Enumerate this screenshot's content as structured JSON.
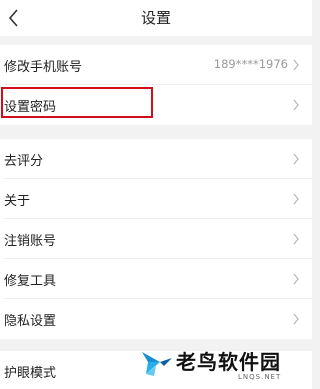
{
  "header": {
    "title": "设置"
  },
  "groups": [
    {
      "items": [
        {
          "label": "修改手机账号",
          "value": "189****1976"
        },
        {
          "label": "设置密码"
        }
      ]
    },
    {
      "items": [
        {
          "label": "去评分"
        },
        {
          "label": "关于"
        },
        {
          "label": "注销账号"
        },
        {
          "label": "修复工具"
        },
        {
          "label": "隐私设置"
        }
      ]
    },
    {
      "items": [
        {
          "label": "护眼模式"
        }
      ]
    }
  ],
  "highlight": {
    "target": "设置密码",
    "color": "#d10f1b"
  },
  "watermark": {
    "brand": "老鸟软件园",
    "site": "LNQS.NET"
  },
  "colors": {
    "background": "#f2f2f2",
    "row": "#ffffff",
    "chevron": "#bbbbbb"
  },
  "icons": {
    "back": "chevron-left-icon",
    "row_arrow": "chevron-right-icon"
  }
}
